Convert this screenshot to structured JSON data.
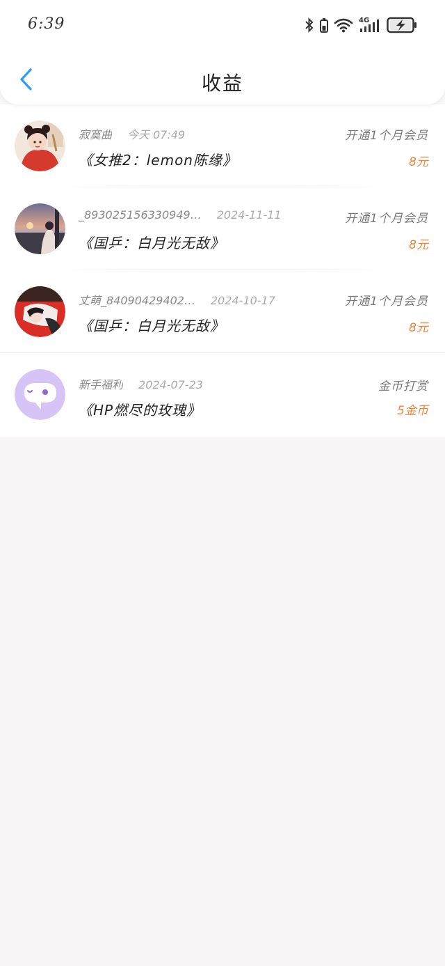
{
  "status": {
    "time": "6:39",
    "network": "4G"
  },
  "nav": {
    "title": "收益"
  },
  "colors": {
    "accent": "#2a9df4",
    "amount": "#e8853a"
  },
  "rows": [
    {
      "name": "寂寞曲",
      "date": "今天 07:49",
      "book": "《女推2：lemon陈缘》",
      "type": "开通1个月会员",
      "amount": "8元"
    },
    {
      "name": "_893025156330949…",
      "date": "2024-11-11",
      "book": "《国乒：白月光无敌》",
      "type": "开通1个月会员",
      "amount": "8元"
    },
    {
      "name": "丈萌_84090429402…",
      "date": "2024-10-17",
      "book": "《国乒：白月光无敌》",
      "type": "开通1个月会员",
      "amount": "8元"
    },
    {
      "name": "新手福利",
      "date": "2024-07-23",
      "book": "《HP燃尽的玫瑰》",
      "type": "金币打赏",
      "amount": "5金币"
    }
  ]
}
